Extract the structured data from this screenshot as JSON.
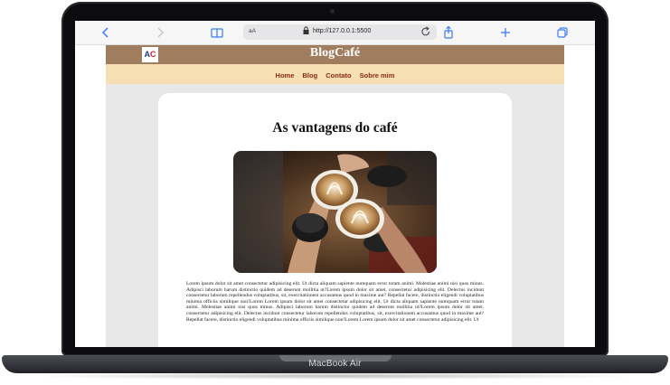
{
  "device": {
    "label": "MacBook Air"
  },
  "browser": {
    "url_text_size": "aA",
    "url": "http://127.0.0.1:5500"
  },
  "site": {
    "logo_text": [
      "A",
      "C"
    ],
    "title": "BlogCafé",
    "nav": [
      "Home",
      "Blog",
      "Contato",
      "Sobre mim"
    ]
  },
  "post": {
    "title": "As vantagens do café",
    "body": "Lorem ipsum dolor sit amet consectetur adipisicing elit. Ut dicta aliquam sapiente numquam error totam animi. Molestiae animi nisi quos minus. Adipisci laborum harum distinctio quidem ad deserunt mollitia ut?Lorem ipsum dolor sit amet, consectetur adipisicing elit. Delectus incidunt consectetur laborum repellendus voluptatibus, sit, exercitationem accusamus quod in maxime aut? Repellat facere, distinctio eligendi voluptatibus minima officiis similique non!Lorem Lorem ipsum dolor sit amet consectetur adipisicing elit. Ut dicta aliquam sapiente numquam error totam animi. Molestiae animi nisi quos minus. Adipisci laborum harum distinctio quidem ad deserunt mollitia ut?Lorem ipsum dolor sit amet, consectetur adipisicing elit. Delectus incidunt consectetur laborum repellendus voluptatibus, sit, exercitationem accusamus quod in maxime aut? Repellat facere, distinctio eligendi voluptatibus minima officiis similique non!Lorem Lorem ipsum dolor sit amet consectetur adipisicing elit. Ut"
  },
  "colors": {
    "header": "#a07d5e",
    "nav_bg": "#f5dfb3",
    "nav_text": "#8a2a12",
    "page_bg": "#e8e8e8",
    "browser_accent": "#3b7cf5"
  },
  "icons": [
    "back-chevron-icon",
    "forward-chevron-icon",
    "reader-book-icon",
    "lock-icon",
    "reload-icon",
    "share-icon",
    "new-tab-plus-icon",
    "tabs-overview-icon"
  ]
}
